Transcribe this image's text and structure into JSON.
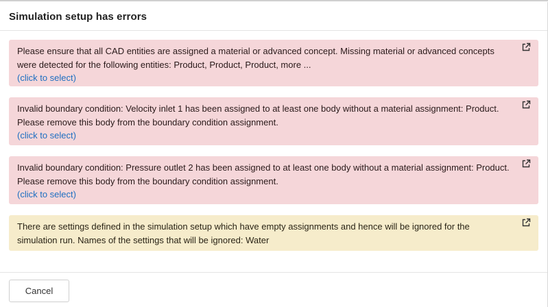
{
  "dialog": {
    "title": "Simulation setup has errors"
  },
  "alerts": [
    {
      "type": "error",
      "message": "Please ensure that all CAD entities are assigned a material or advanced concept. Missing material or advanced concepts were detected for the following entities: Product, Product, Product, more ...",
      "link": "(click to select)",
      "icon": "external-link-icon"
    },
    {
      "type": "error",
      "message": "Invalid boundary condition: Velocity inlet 1 has been assigned to at least one body without a material assignment: Product. Please remove this body from the boundary condition assignment.",
      "link": "(click to select)",
      "icon": "external-link-icon"
    },
    {
      "type": "error",
      "message": "Invalid boundary condition: Pressure outlet 2 has been assigned to at least one body without a material assignment: Product. Please remove this body from the boundary condition assignment.",
      "link": "(click to select)",
      "icon": "external-link-icon"
    },
    {
      "type": "warning",
      "message": "There are settings defined in the simulation setup which have empty assignments and hence will be ignored for the simulation run. Names of the settings that will be ignored: Water",
      "icon": "external-link-icon"
    }
  ],
  "footer": {
    "cancel_label": "Cancel"
  },
  "colors": {
    "error_bg": "#f5d6d9",
    "warning_bg": "#f6eccb",
    "link": "#1d6fc1"
  }
}
